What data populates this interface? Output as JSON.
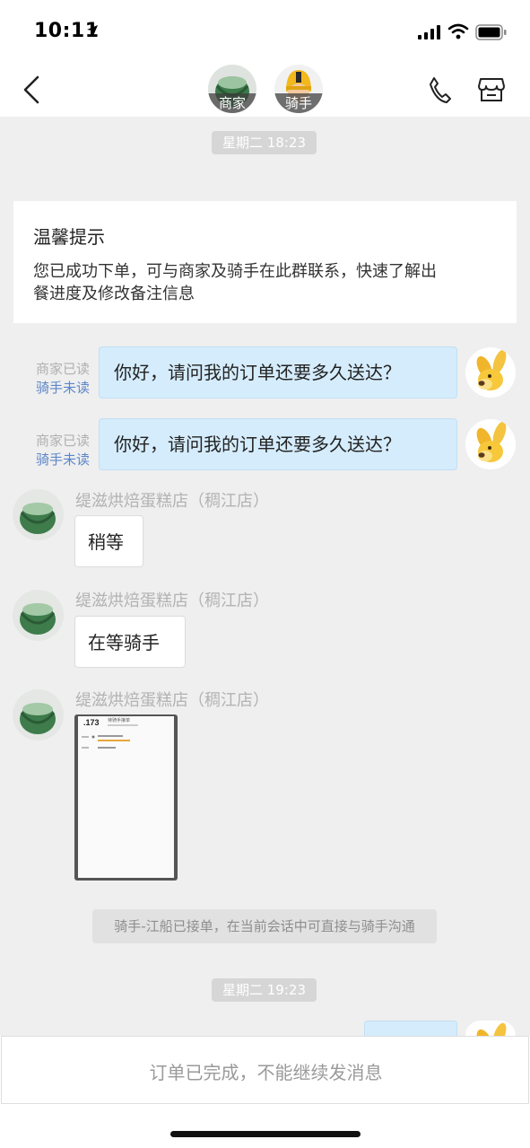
{
  "status_bar": {
    "time": "10:11"
  },
  "header": {
    "merchant_label": "商家",
    "rider_label": "骑手"
  },
  "timestamps": [
    "星期二 18:23",
    "星期二 19:23"
  ],
  "tip": {
    "title": "温馨提示",
    "line1": "您已成功下单，可与商家及骑手在此群联系，快速了解出",
    "line2": "餐进度及修改备注信息"
  },
  "outgoing_messages": [
    {
      "text": "你好，请问我的订单还要多久送达？",
      "merchant_status": "商家已读",
      "rider_status": "骑手未读"
    },
    {
      "text": "你好，请问我的订单还要多久送达？",
      "merchant_status": "商家已读",
      "rider_status": "骑手未读"
    }
  ],
  "incoming_messages": [
    {
      "sender": "缇滋烘焙蛋糕店（稠江店）",
      "text": "稍等"
    },
    {
      "sender": "缇滋烘焙蛋糕店（稠江店）",
      "text": "在等骑手"
    },
    {
      "sender": "缇滋烘焙蛋糕店（稠江店）",
      "image": true
    }
  ],
  "image_preview": {
    "number": "173",
    "heading": "待骑手接单"
  },
  "system_notice": "骑手-江船已接单，在当前会话中可直接与骑手沟通",
  "bottom_notice": "订单已完成，不能继续发消息",
  "colors": {
    "bubble_out": "#d5ecfc",
    "read_status_rider": "#5b86c9",
    "timestamp_bg": "#d6d6d6"
  },
  "icons": [
    "location-arrow-icon",
    "signal-icon",
    "wifi-icon",
    "battery-icon",
    "back-chevron-icon",
    "phone-icon",
    "shop-icon"
  ]
}
